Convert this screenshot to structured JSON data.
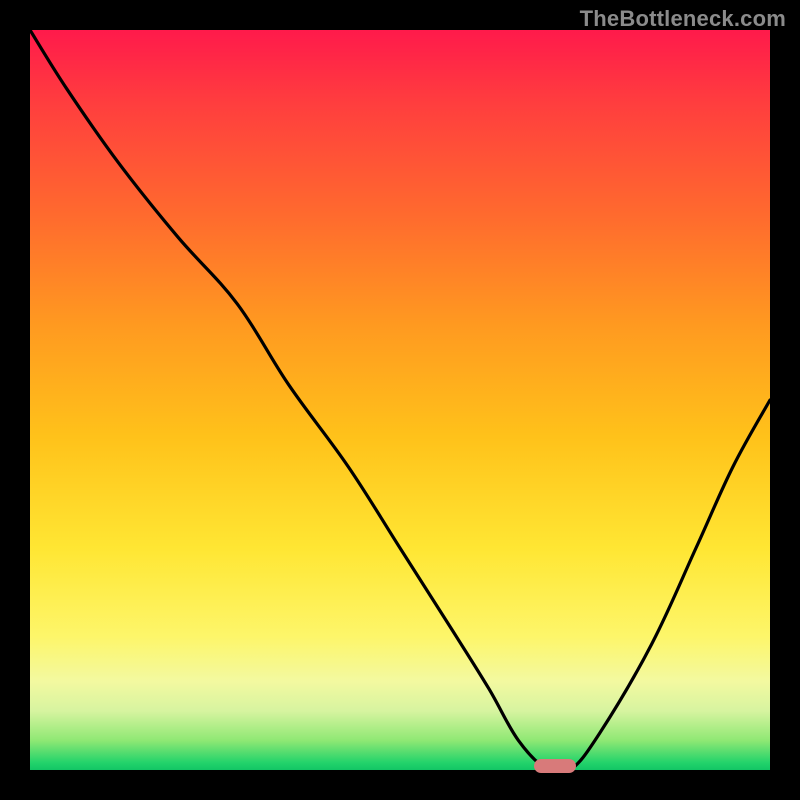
{
  "watermark": "TheBottleneck.com",
  "colors": {
    "frame": "#000000",
    "watermark": "#8b8b8b",
    "curve": "#000000",
    "marker": "#d87a7a",
    "gradient_top": "#ff1a4b",
    "gradient_bottom": "#12c565"
  },
  "chart_data": {
    "type": "line",
    "title": "",
    "xlabel": "",
    "ylabel": "",
    "xlim": [
      0,
      100
    ],
    "ylim": [
      0,
      100
    ],
    "grid": false,
    "legend": false,
    "series": [
      {
        "name": "bottleneck-curve",
        "x": [
          0,
          5,
          12,
          20,
          28,
          35,
          43,
          50,
          57,
          62,
          66,
          70,
          73,
          77,
          84,
          90,
          95,
          100
        ],
        "values": [
          100,
          92,
          82,
          72,
          63,
          52,
          41,
          30,
          19,
          11,
          4,
          0,
          0,
          5,
          17,
          30,
          41,
          50
        ]
      }
    ],
    "marker": {
      "x": 71,
      "y": 0
    }
  }
}
